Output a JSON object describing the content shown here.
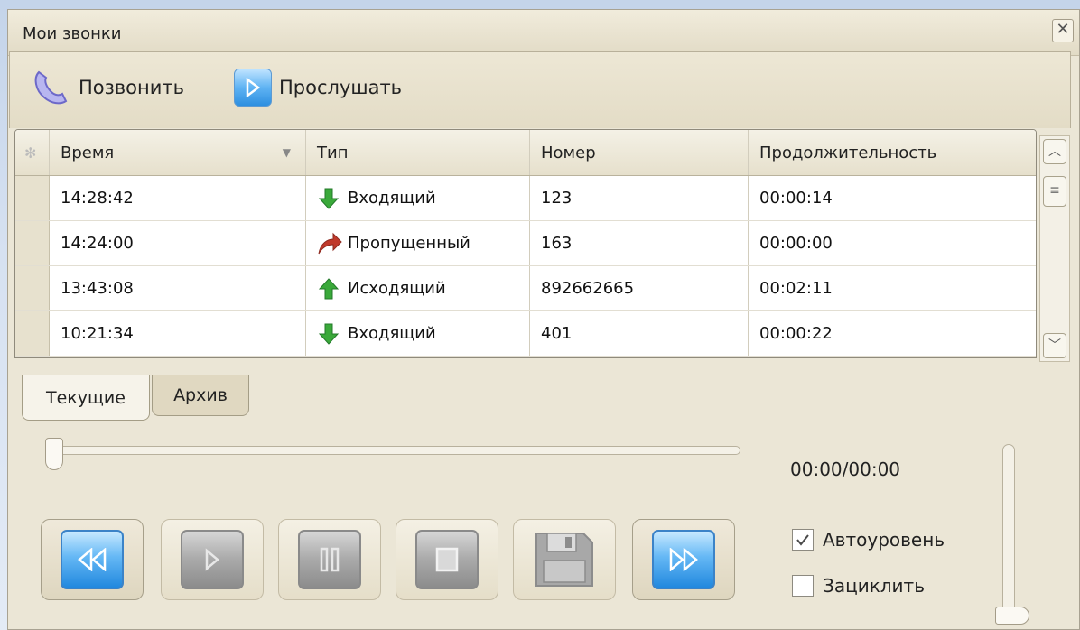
{
  "window": {
    "title": "Мои звонки",
    "close_glyph": "✕"
  },
  "toolbar": {
    "call_label": "Позвонить",
    "listen_label": "Прослушать"
  },
  "grid": {
    "columns": [
      "Время",
      "Тип",
      "Номер",
      "Продолжительность"
    ],
    "rows": [
      {
        "time": "14:28:42",
        "type": "Входящий",
        "type_icon": "incoming-arrow-icon",
        "number": "123",
        "duration": "00:00:14"
      },
      {
        "time": "14:24:00",
        "type": "Пропущенный",
        "type_icon": "missed-arrow-icon",
        "number": "163",
        "duration": "00:00:00"
      },
      {
        "time": "13:43:08",
        "type": "Исходящий",
        "type_icon": "outgoing-arrow-icon",
        "number": "892662665",
        "duration": "00:02:11"
      },
      {
        "time": "10:21:34",
        "type": "Входящий",
        "type_icon": "incoming-arrow-icon",
        "number": "401",
        "duration": "00:00:22"
      }
    ]
  },
  "tabs": {
    "current": "Текущие",
    "archive": "Архив"
  },
  "player": {
    "timecode": "00:00/00:00",
    "position_fraction": 0,
    "volume_fraction": 0,
    "autolevel_label": "Автоуровень",
    "autolevel_checked": true,
    "loop_label": "Зациклить",
    "loop_checked": false
  },
  "colors": {
    "accent_blue": "#2d8fe0",
    "incoming_green": "#3aa93a",
    "missed_red": "#c0392b"
  }
}
